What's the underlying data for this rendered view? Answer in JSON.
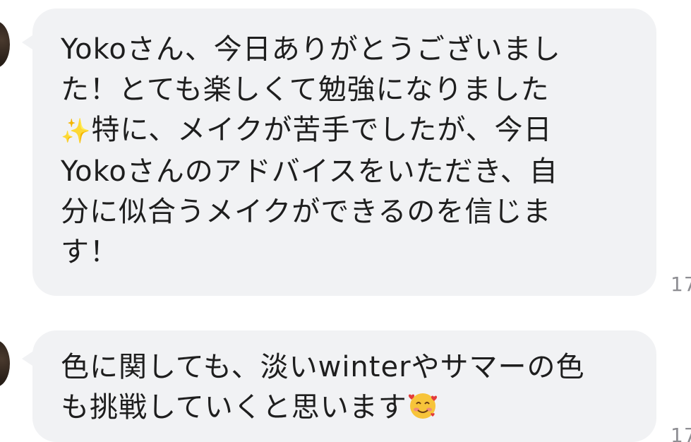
{
  "messages": [
    {
      "lines": [
        "Yokoさん、今日ありがとうございまし",
        "た！とても楽しくて勉強になりました",
        "特に、メイクが苦手でしたが、今日",
        "Yokoさんのアドバイスをいただき、自",
        "分に似合うメイクができるのを信じま",
        "す！"
      ],
      "icon_line3": "sparkles-icon",
      "timestamp": "17"
    },
    {
      "lines": [
        "色に関しても、淡いwinterやサマーの色",
        "も挑戦していくと思います"
      ],
      "icon_line2": "smiling-face-with-hearts-icon",
      "timestamp": "17"
    }
  ],
  "colors": {
    "bubble": "#f1f2f4",
    "text": "#1e1e1e",
    "timestamp": "#8e8e93"
  }
}
